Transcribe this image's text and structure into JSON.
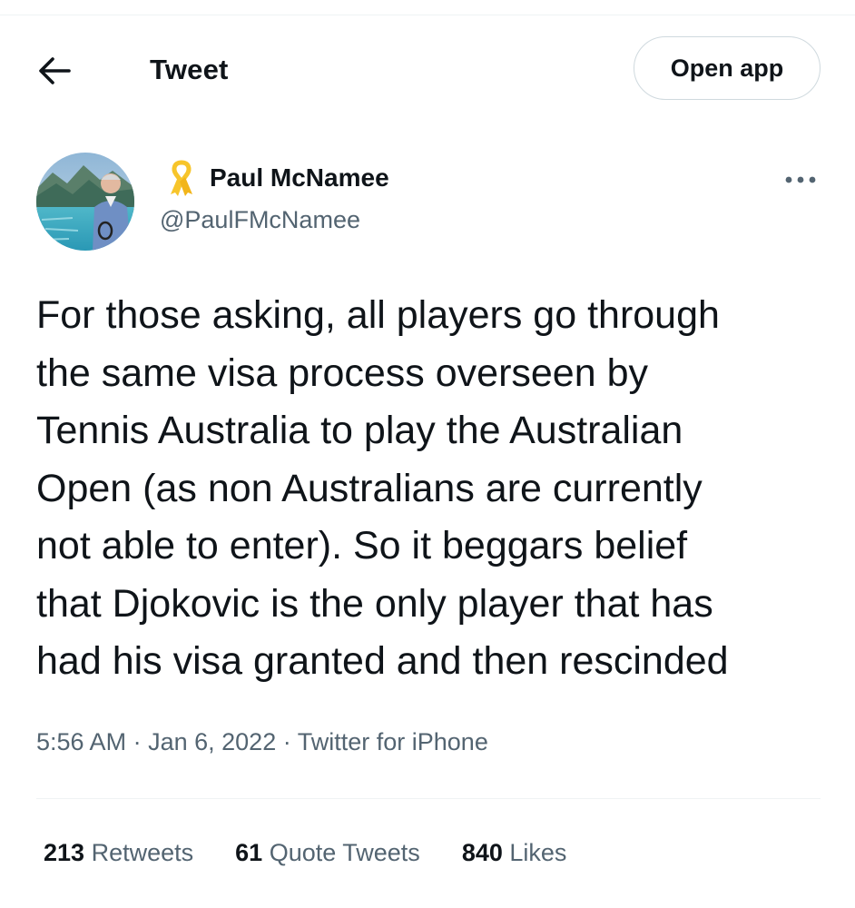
{
  "header": {
    "back_icon": "arrow-left-icon",
    "title": "Tweet",
    "open_app_label": "Open app"
  },
  "author": {
    "badge_icon": "yellow-ribbon-icon",
    "badge_color": "#f7c52b",
    "display_name": "Paul McNamee",
    "handle": "@PaulFMcNamee",
    "more_icon": "more-horizontal-icon"
  },
  "tweet": {
    "text": "For those asking, all players go through\nthe same visa process overseen by\nTennis Australia to play the Australian\nOpen (as non Australians are currently\nnot able to enter). So it beggars belief\nthat Djokovic is the only player that has\nhad his visa granted and then rescinded",
    "time": "5:56 AM",
    "separator": "·",
    "date": "Jan 6, 2022",
    "source": "Twitter for iPhone"
  },
  "stats": [
    {
      "count": "213",
      "label": "Retweets"
    },
    {
      "count": "61",
      "label": "Quote Tweets"
    },
    {
      "count": "840",
      "label": "Likes"
    }
  ],
  "colors": {
    "text_primary": "#0f1419",
    "text_secondary": "#536471",
    "border": "#cfd9de",
    "divider": "#eff3f4"
  }
}
